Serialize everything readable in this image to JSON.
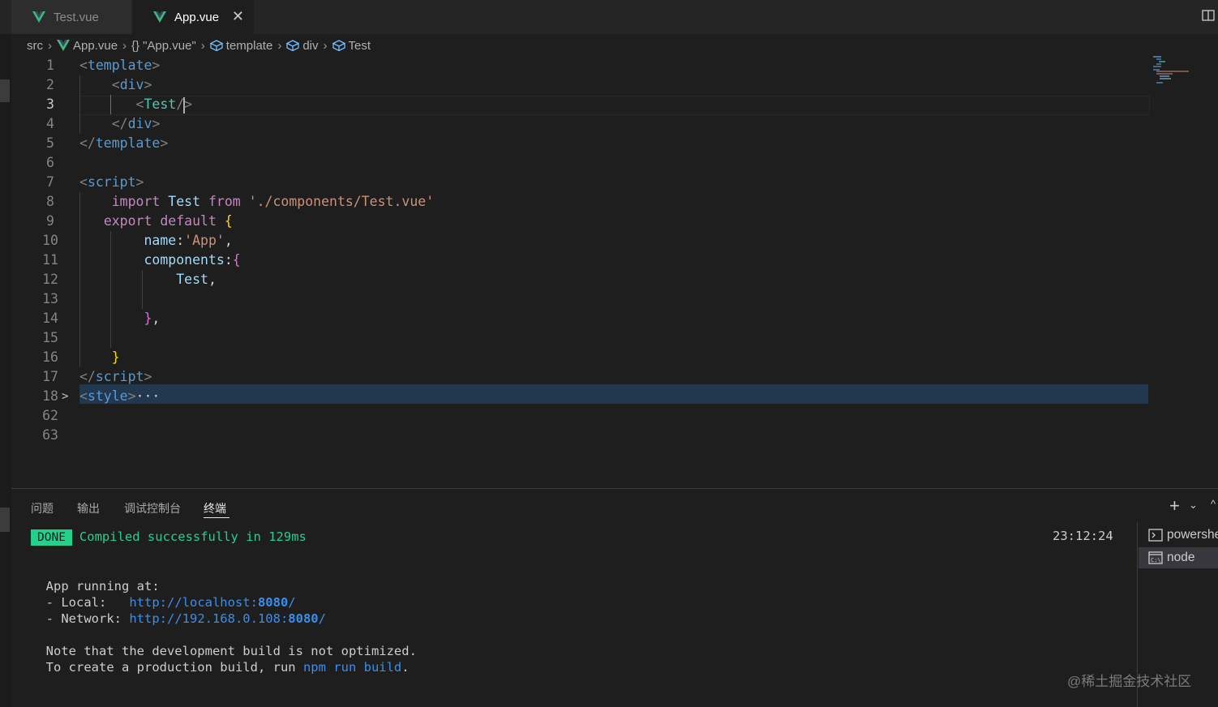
{
  "colors": {
    "background": "#1e1e1e",
    "tab_bar": "#252526",
    "vue_green": "#41b883",
    "done_badge": "#23d18b",
    "link_blue": "#3b8eea",
    "selection": "#264f78"
  },
  "tabs": [
    {
      "label": "Test.vue",
      "icon": "vue-icon"
    },
    {
      "label": "App.vue",
      "icon": "vue-icon",
      "close": "✕"
    }
  ],
  "breadcrumbs": {
    "items": [
      "src",
      "App.vue",
      "\"App.vue\"",
      "template",
      "div",
      "Test"
    ],
    "braces": "{}",
    "separator": "›"
  },
  "editor": {
    "line_numbers": [
      "1",
      "2",
      "3",
      "4",
      "5",
      "6",
      "7",
      "8",
      "9",
      "10",
      "11",
      "12",
      "13",
      "14",
      "15",
      "16",
      "17",
      "18",
      "62",
      "63"
    ],
    "current_line": "3",
    "folded_ellipsis": "···"
  },
  "panel": {
    "tabs": [
      "问题",
      "输出",
      "调试控制台",
      "终端"
    ],
    "active_tab": "终端",
    "done_badge": "DONE",
    "compiled_message": "Compiled successfully in 129ms",
    "timestamp": "23:12:24",
    "app_running": "App running at:",
    "local_label": "- Local:   ",
    "local_url_prefix": "http://localhost:",
    "local_port": "8080",
    "local_url_suffix": "/",
    "network_label": "- Network: ",
    "network_url_prefix": "http://192.168.0.108:",
    "network_port": "8080",
    "network_url_suffix": "/",
    "note_line": "Note that the development build is not optimized.",
    "create_line_prefix": "To create a production build, run ",
    "create_cmd": "npm run build",
    "create_line_suffix": ".",
    "terminals": [
      {
        "label": "powershell",
        "icon": "powershell-icon"
      },
      {
        "label": "node",
        "icon": "cmd-icon"
      }
    ]
  },
  "watermark": "@稀土掘金技术社区"
}
